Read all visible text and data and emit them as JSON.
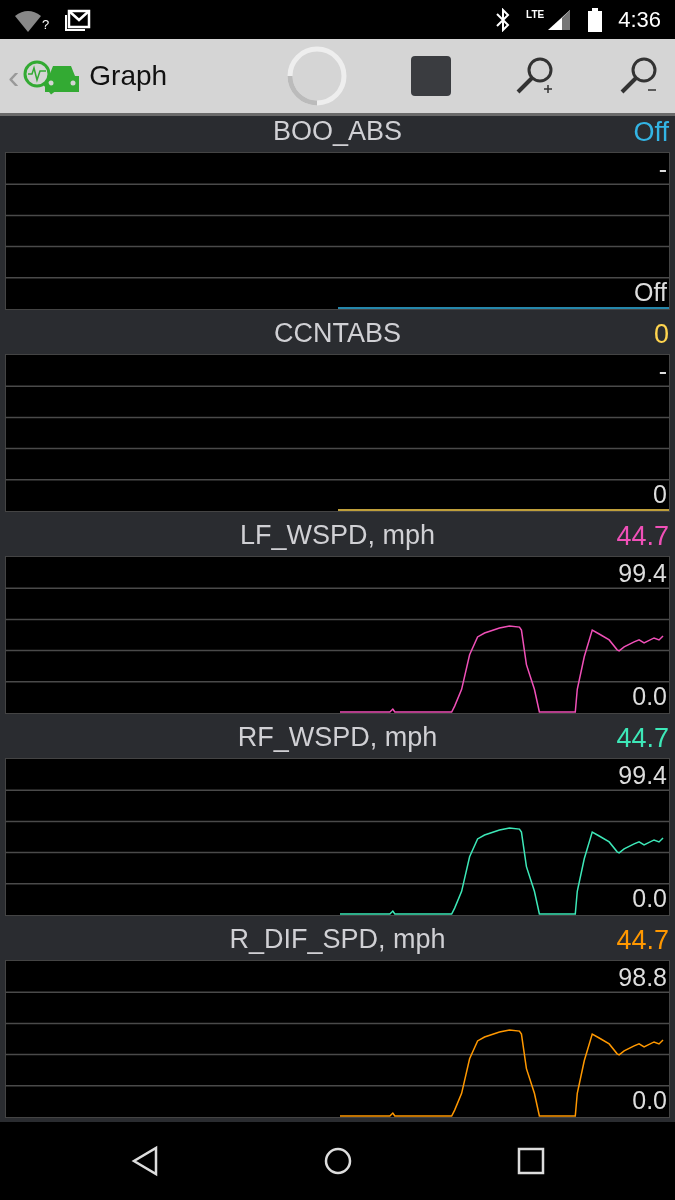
{
  "status_bar": {
    "wifi_label": "?",
    "network": "LTE",
    "time": "4:36"
  },
  "toolbar": {
    "back": "‹",
    "title": "Graph"
  },
  "panels": [
    {
      "title": "BOO_ABS",
      "value": "Off",
      "color": "#33b5e5",
      "max_label": "-",
      "min_label": "Off",
      "kind": "flat"
    },
    {
      "title": "CCNTABS",
      "value": "0",
      "color": "#ffd54f",
      "max_label": "-",
      "min_label": "0",
      "kind": "flat"
    },
    {
      "title": "LF_WSPD, mph",
      "value": "44.7",
      "color": "#f050b8",
      "max_label": "99.4",
      "min_label": "0.0",
      "kind": "wave"
    },
    {
      "title": "RF_WSPD, mph",
      "value": "44.7",
      "color": "#3de8b8",
      "max_label": "99.4",
      "min_label": "0.0",
      "kind": "wave"
    },
    {
      "title": "R_DIF_SPD, mph",
      "value": "44.7",
      "color": "#ff9800",
      "max_label": "98.8",
      "min_label": "0.0",
      "kind": "wave"
    }
  ]
}
